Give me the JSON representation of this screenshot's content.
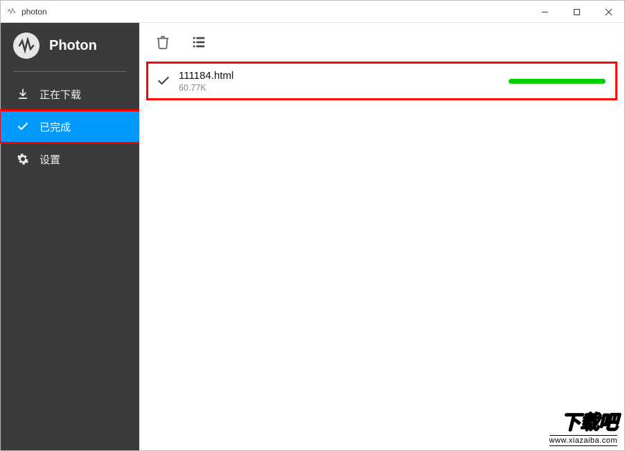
{
  "window": {
    "title": "photon"
  },
  "brand": {
    "name": "Photon"
  },
  "sidebar": {
    "items": [
      {
        "label": "正在下载",
        "icon": "download-icon",
        "active": false
      },
      {
        "label": "已完成",
        "icon": "check-icon",
        "active": true
      },
      {
        "label": "设置",
        "icon": "gear-icon",
        "active": false
      }
    ]
  },
  "downloads": [
    {
      "name": "111184.html",
      "size": "60.77K",
      "status": "completed",
      "progress_color": "#00d000"
    }
  ],
  "watermark": {
    "text": "下载吧",
    "url": "www.xiazaiba.com"
  }
}
